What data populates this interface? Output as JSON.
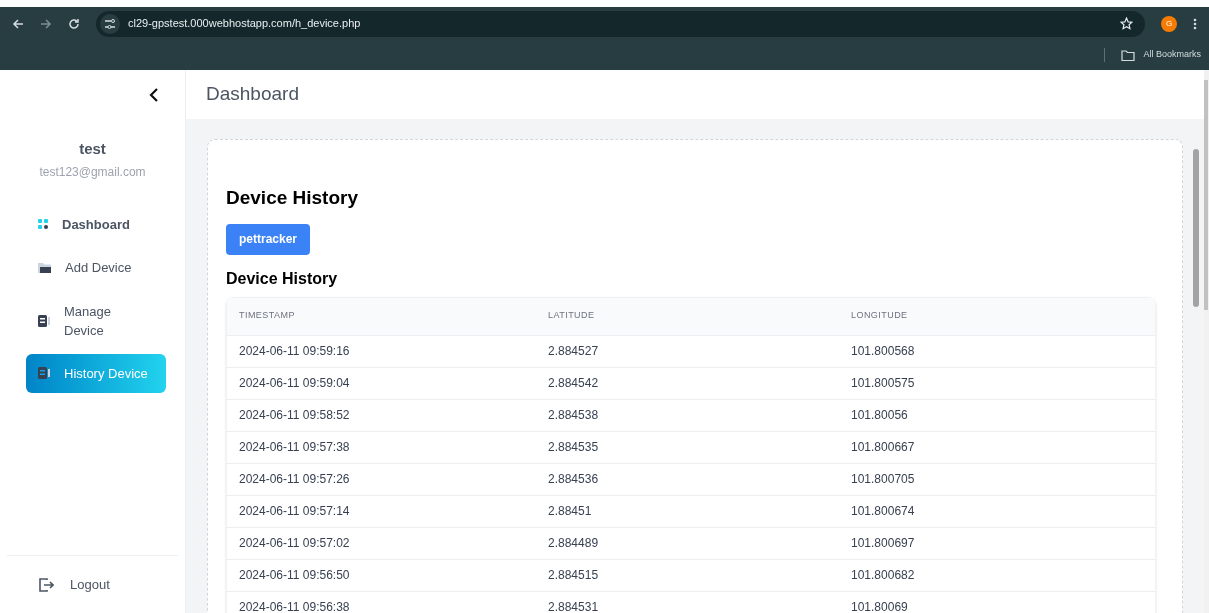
{
  "browser": {
    "url": "cl29-gpstest.000webhostapp.com/h_device.php",
    "profile_initial": "G",
    "bookmarks_label": "All Bookmarks"
  },
  "sidebar": {
    "user_name": "test",
    "user_email": "test123@gmail.com",
    "items": [
      {
        "label": "Dashboard",
        "kind": "dashboard",
        "selected": false
      },
      {
        "label": "Add Device",
        "kind": "add",
        "selected": false
      },
      {
        "label": "Manage Device",
        "kind": "manage",
        "selected": false
      },
      {
        "label": "History Device",
        "kind": "history",
        "selected": true
      }
    ],
    "logout": "Logout"
  },
  "header": {
    "title": "Dashboard"
  },
  "content": {
    "title": "Device History",
    "device_button": "pettracker",
    "table_title": "Device History",
    "table": {
      "columns": [
        "TIMESTAMP",
        "LATITUDE",
        "LONGITUDE"
      ],
      "rows": [
        [
          "2024-06-11 09:59:16",
          "2.884527",
          "101.800568"
        ],
        [
          "2024-06-11 09:59:04",
          "2.884542",
          "101.800575"
        ],
        [
          "2024-06-11 09:58:52",
          "2.884538",
          "101.80056"
        ],
        [
          "2024-06-11 09:57:38",
          "2.884535",
          "101.800667"
        ],
        [
          "2024-06-11 09:57:26",
          "2.884536",
          "101.800705"
        ],
        [
          "2024-06-11 09:57:14",
          "2.88451",
          "101.800674"
        ],
        [
          "2024-06-11 09:57:02",
          "2.884489",
          "101.800697"
        ],
        [
          "2024-06-11 09:56:50",
          "2.884515",
          "101.800682"
        ],
        [
          "2024-06-11 09:56:38",
          "2.884531",
          "101.80069"
        ]
      ]
    }
  }
}
